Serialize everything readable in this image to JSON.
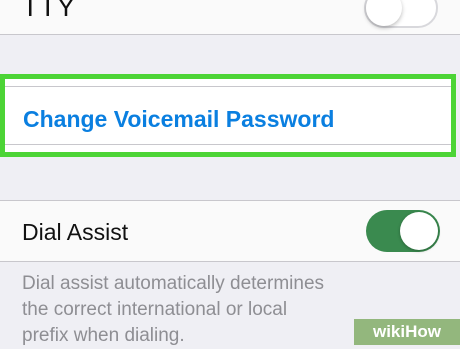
{
  "settings": {
    "tty": {
      "label": "TTY",
      "enabled": false
    },
    "voicemail": {
      "change_password_label": "Change Voicemail Password"
    },
    "dial_assist": {
      "label": "Dial Assist",
      "enabled": true,
      "description_lines": [
        "Dial assist automatically determines",
        "the correct international or local",
        "prefix when dialing."
      ]
    }
  },
  "colors": {
    "highlight": "#4cd436",
    "link": "#0a7fe0",
    "toggle_on": "#3a8a4f",
    "badge": "#93b77d"
  },
  "watermark": {
    "part1": "wiki",
    "part2": "How"
  }
}
